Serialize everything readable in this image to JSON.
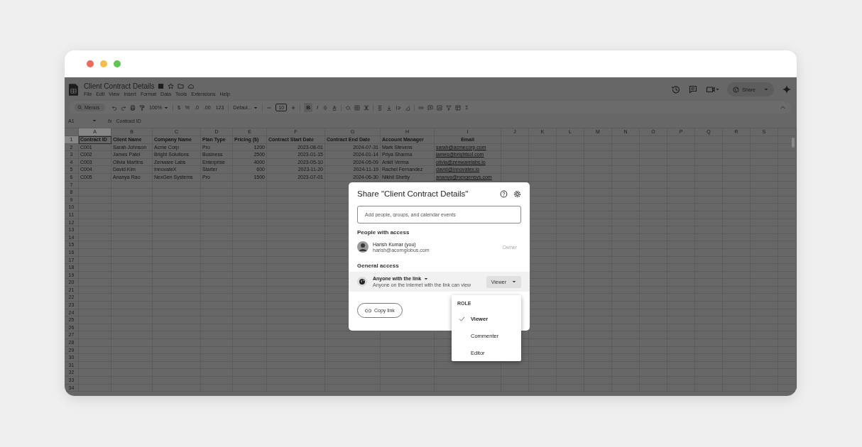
{
  "window": {
    "controls": [
      {
        "color": "#ed6a5e"
      },
      {
        "color": "#f5bf4f"
      },
      {
        "color": "#61c554"
      }
    ]
  },
  "document": {
    "title": "Client Contract Details",
    "menu": [
      "File",
      "Edit",
      "View",
      "Insert",
      "Format",
      "Data",
      "Tools",
      "Extensions",
      "Help"
    ]
  },
  "share_button": {
    "label": "Share"
  },
  "toolbar": [
    {
      "kind": "search",
      "label": "Menus"
    },
    {
      "kind": "undo"
    },
    {
      "kind": "redo"
    },
    {
      "kind": "print"
    },
    {
      "kind": "paint"
    },
    {
      "kind": "dropdown",
      "label": "100%"
    },
    {
      "kind": "sep"
    },
    {
      "kind": "text",
      "label": "$"
    },
    {
      "kind": "text",
      "label": "%"
    },
    {
      "kind": "text",
      "label": ".0"
    },
    {
      "kind": "text",
      "label": ".00"
    },
    {
      "kind": "text",
      "label": "123"
    },
    {
      "kind": "sep"
    },
    {
      "kind": "dropdown",
      "label": "Defaul..."
    },
    {
      "kind": "sep"
    },
    {
      "kind": "minus"
    },
    {
      "kind": "size",
      "label": "10"
    },
    {
      "kind": "plus"
    },
    {
      "kind": "sep"
    },
    {
      "kind": "bold",
      "label": "B"
    },
    {
      "kind": "italic",
      "label": "I"
    },
    {
      "kind": "strike"
    },
    {
      "kind": "textcolor"
    },
    {
      "kind": "sep"
    },
    {
      "kind": "fill"
    },
    {
      "kind": "borders"
    },
    {
      "kind": "merge"
    },
    {
      "kind": "sep"
    },
    {
      "kind": "halign"
    },
    {
      "kind": "valign"
    },
    {
      "kind": "wrap"
    },
    {
      "kind": "rotate"
    },
    {
      "kind": "sep"
    },
    {
      "kind": "link"
    },
    {
      "kind": "comment"
    },
    {
      "kind": "chart"
    },
    {
      "kind": "filter"
    },
    {
      "kind": "views"
    },
    {
      "kind": "text",
      "label": "Σ"
    }
  ],
  "formula_bar": {
    "cell": "A1",
    "fx": "fx",
    "value": "Contract ID"
  },
  "sheet": {
    "columns": [
      {
        "letter": "A",
        "kind": "text",
        "selected": true
      },
      {
        "letter": "B",
        "kind": "text",
        "selected": false
      },
      {
        "letter": "C",
        "kind": "text",
        "selected": false
      },
      {
        "letter": "D",
        "kind": "text",
        "selected": false
      },
      {
        "letter": "E",
        "kind": "number",
        "selected": false
      },
      {
        "letter": "F",
        "kind": "number",
        "selected": false
      },
      {
        "letter": "G",
        "kind": "number",
        "selected": false
      },
      {
        "letter": "H",
        "kind": "text",
        "selected": false
      },
      {
        "letter": "I",
        "kind": "link",
        "selected": false
      },
      {
        "letter": "J",
        "selected": false
      },
      {
        "letter": "K",
        "selected": false
      },
      {
        "letter": "L",
        "selected": false
      },
      {
        "letter": "M",
        "selected": false
      },
      {
        "letter": "N",
        "selected": false
      },
      {
        "letter": "O",
        "selected": false
      },
      {
        "letter": "P",
        "selected": false
      },
      {
        "letter": "Q",
        "selected": false
      },
      {
        "letter": "R",
        "selected": false
      },
      {
        "letter": "S",
        "selected": false
      }
    ],
    "rows": [
      {
        "number": "1",
        "kind": "header",
        "selected": true,
        "cells": [
          "Contract ID",
          "Client Name",
          "Company Name",
          "Plan Type",
          "Pricing ($)",
          "Contract Start Date",
          "Contract End Date",
          "Account Manager",
          "Email"
        ]
      },
      {
        "number": "2",
        "kind": "data",
        "selected": false,
        "cells": [
          "C001",
          "Sarah Johnson",
          "Acme Corp",
          "Pro",
          "1200",
          "2023-08-01",
          "2024-07-31",
          "Mark Stevens",
          "sarah@acmecorp.com"
        ]
      },
      {
        "number": "3",
        "kind": "data",
        "selected": false,
        "cells": [
          "C002",
          "James Patel",
          "Bright Solutions",
          "Business",
          "2500",
          "2023-01-15",
          "2024-01-14",
          "Priya Sharma",
          "james@brightsol.com"
        ]
      },
      {
        "number": "4",
        "kind": "data",
        "selected": false,
        "cells": [
          "C003",
          "Olivia Martins",
          "Zenware Labs",
          "Enterprise",
          "4000",
          "2023-05-10",
          "2024-05-09",
          "Ankit Verma",
          "olivia@zenwarelabs.io"
        ]
      },
      {
        "number": "5",
        "kind": "data",
        "selected": false,
        "cells": [
          "C004",
          "David Kim",
          "InnovateX",
          "Starter",
          "600",
          "2023-11-20",
          "2024-11-19",
          "Rachel Fernandez",
          "david@innovatex.io"
        ]
      },
      {
        "number": "6",
        "kind": "data",
        "selected": false,
        "cells": [
          "C005",
          "Ananya Rao",
          "NexGen Systems",
          "Pro",
          "1500",
          "2023-07-01",
          "2024-06-30",
          "Nikhil Shetty",
          "ananya@nexgensys.com"
        ]
      },
      {
        "number": "7",
        "selected": false,
        "cells": []
      },
      {
        "number": "8",
        "selected": false,
        "cells": []
      },
      {
        "number": "9",
        "selected": false,
        "cells": []
      },
      {
        "number": "10",
        "selected": false,
        "cells": []
      },
      {
        "number": "11",
        "selected": false,
        "cells": []
      },
      {
        "number": "12",
        "selected": false,
        "cells": []
      },
      {
        "number": "13",
        "selected": false,
        "cells": []
      },
      {
        "number": "14",
        "selected": false,
        "cells": []
      },
      {
        "number": "15",
        "selected": false,
        "cells": []
      },
      {
        "number": "16",
        "selected": false,
        "cells": []
      },
      {
        "number": "17",
        "selected": false,
        "cells": []
      },
      {
        "number": "18",
        "selected": false,
        "cells": []
      },
      {
        "number": "19",
        "selected": false,
        "cells": []
      },
      {
        "number": "20",
        "selected": false,
        "cells": []
      },
      {
        "number": "21",
        "selected": false,
        "cells": []
      },
      {
        "number": "22",
        "selected": false,
        "cells": []
      },
      {
        "number": "23",
        "selected": false,
        "cells": []
      },
      {
        "number": "24",
        "selected": false,
        "cells": []
      },
      {
        "number": "25",
        "selected": false,
        "cells": []
      },
      {
        "number": "26",
        "selected": false,
        "cells": []
      },
      {
        "number": "27",
        "selected": false,
        "cells": []
      },
      {
        "number": "28",
        "selected": false,
        "cells": []
      },
      {
        "number": "29",
        "selected": false,
        "cells": []
      },
      {
        "number": "30",
        "selected": false,
        "cells": []
      },
      {
        "number": "31",
        "selected": false,
        "cells": []
      },
      {
        "number": "32",
        "selected": false,
        "cells": []
      },
      {
        "number": "33",
        "selected": false,
        "cells": []
      },
      {
        "number": "34",
        "selected": false,
        "cells": []
      }
    ]
  },
  "share_dialog": {
    "title": "Share \"Client Contract Details\"",
    "add_people": {
      "placeholder": "Add people, groups, and calendar events"
    },
    "people_heading": "People with access",
    "people": [
      {
        "name": "Harish Kumar (you)",
        "email": "harish@acornglobus.com",
        "role": "Owner"
      }
    ],
    "general_heading": "General access",
    "general_access": {
      "label": "Anyone with the link",
      "description": "Anyone on the internet with the link can view",
      "role": "Viewer"
    },
    "copy_link": "Copy link"
  },
  "role_menu": {
    "heading": "ROLE",
    "items": [
      {
        "label": "Viewer",
        "selected": true
      },
      {
        "label": "Commenter",
        "selected": false
      },
      {
        "label": "Editor",
        "selected": false
      }
    ]
  }
}
